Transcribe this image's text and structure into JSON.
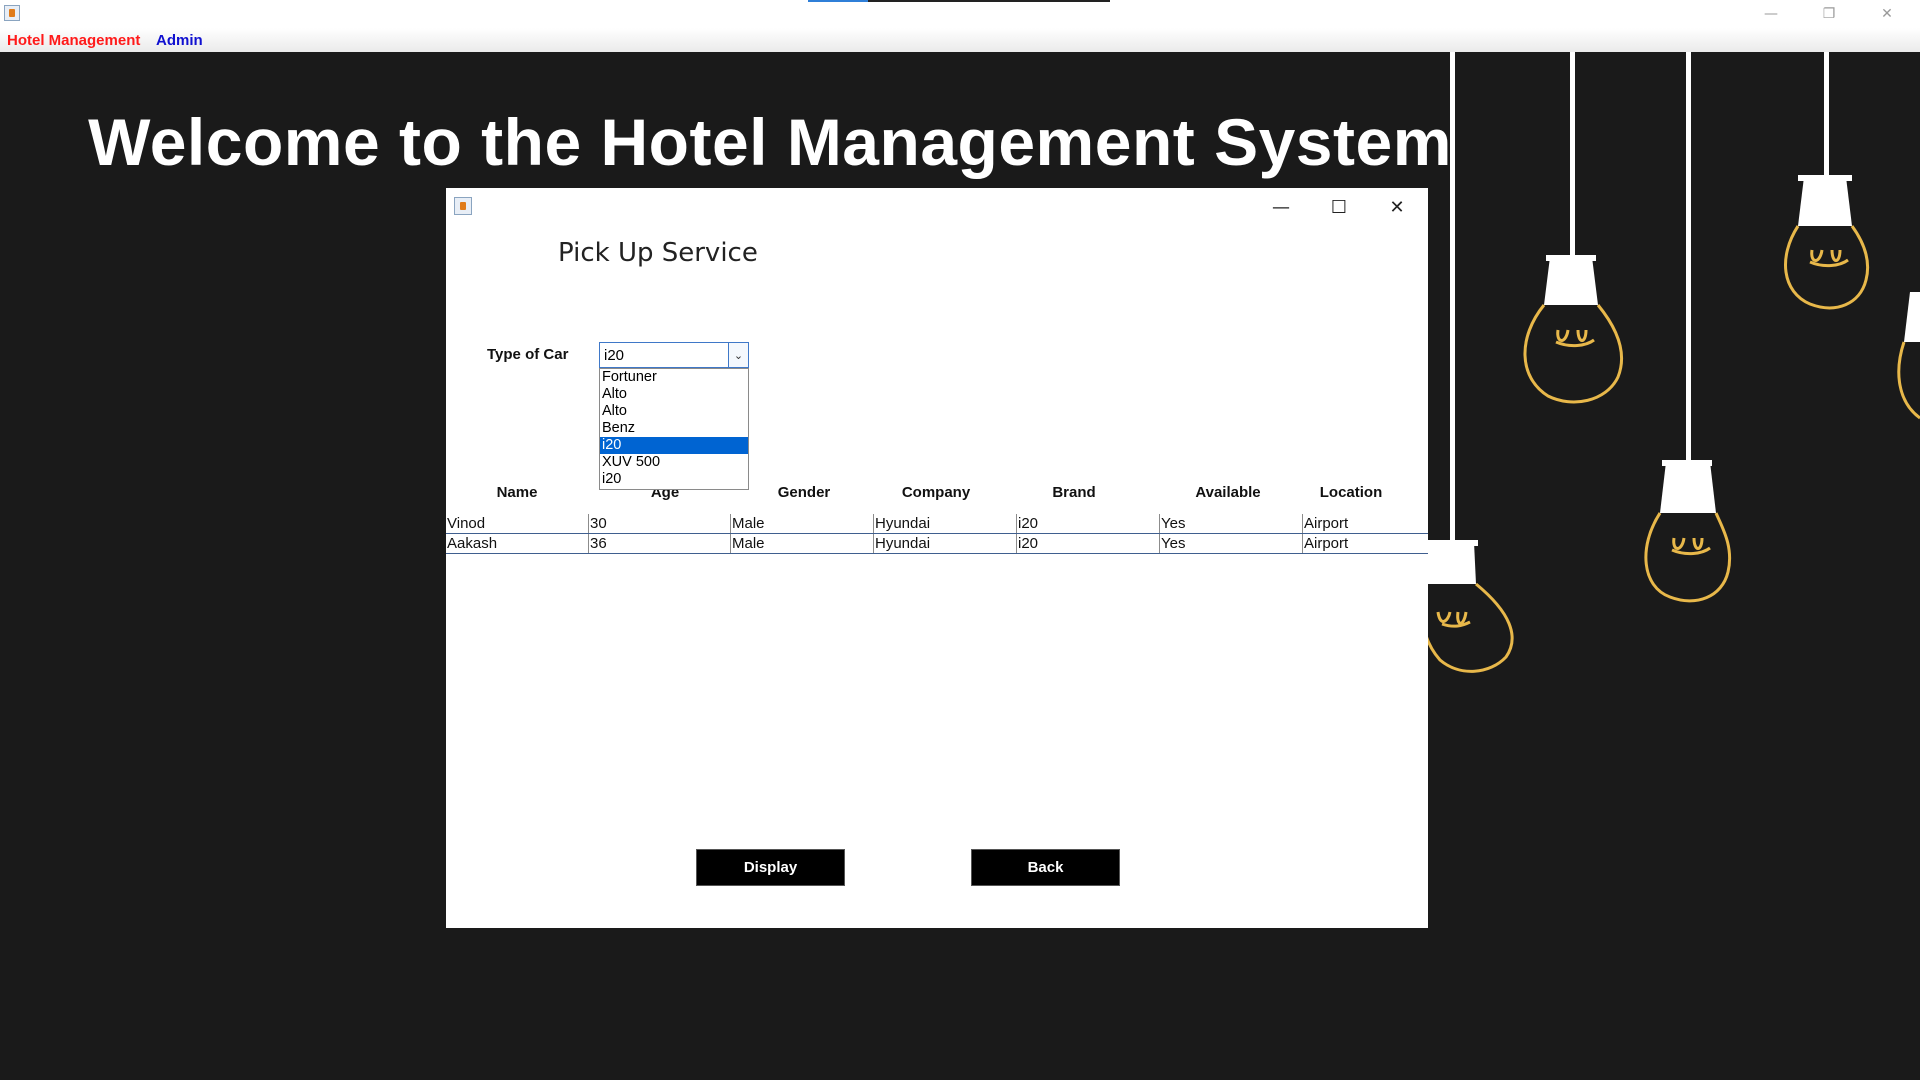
{
  "window": {
    "minimize_glyph": "—",
    "restore_glyph": "❐",
    "close_glyph": "✕"
  },
  "menubar": {
    "items": [
      {
        "label": "Hotel Management",
        "color": "#ff1a1a"
      },
      {
        "label": "Admin",
        "color": "#1010d0"
      }
    ]
  },
  "background": {
    "welcome_text": "Welcome to the Hotel Management System"
  },
  "dialog": {
    "title": "Pick Up Service",
    "controls": {
      "minimize": "—",
      "maximize": "☐",
      "close": "✕"
    },
    "car_field": {
      "label": "Type of Car",
      "selected": "i20",
      "options": [
        "Fortuner",
        "Alto",
        "Alto",
        "Benz",
        "i20",
        "XUV 500",
        "i20"
      ],
      "highlighted_index": 4
    },
    "table": {
      "headers": [
        "Name",
        "Age",
        "Gender",
        "Company",
        "Brand",
        "Available",
        "Location"
      ],
      "rows": [
        [
          "Vinod",
          "30",
          "Male",
          "Hyundai",
          "i20",
          "Yes",
          "Airport"
        ],
        [
          "Aakash",
          "36",
          "Male",
          "Hyundai",
          "i20",
          "Yes",
          "Airport"
        ]
      ]
    },
    "buttons": {
      "display": "Display",
      "back": "Back"
    }
  },
  "colors": {
    "background": "#1a1a1a",
    "selection": "#0064d2",
    "bulb_filament": "#e8b84a"
  }
}
